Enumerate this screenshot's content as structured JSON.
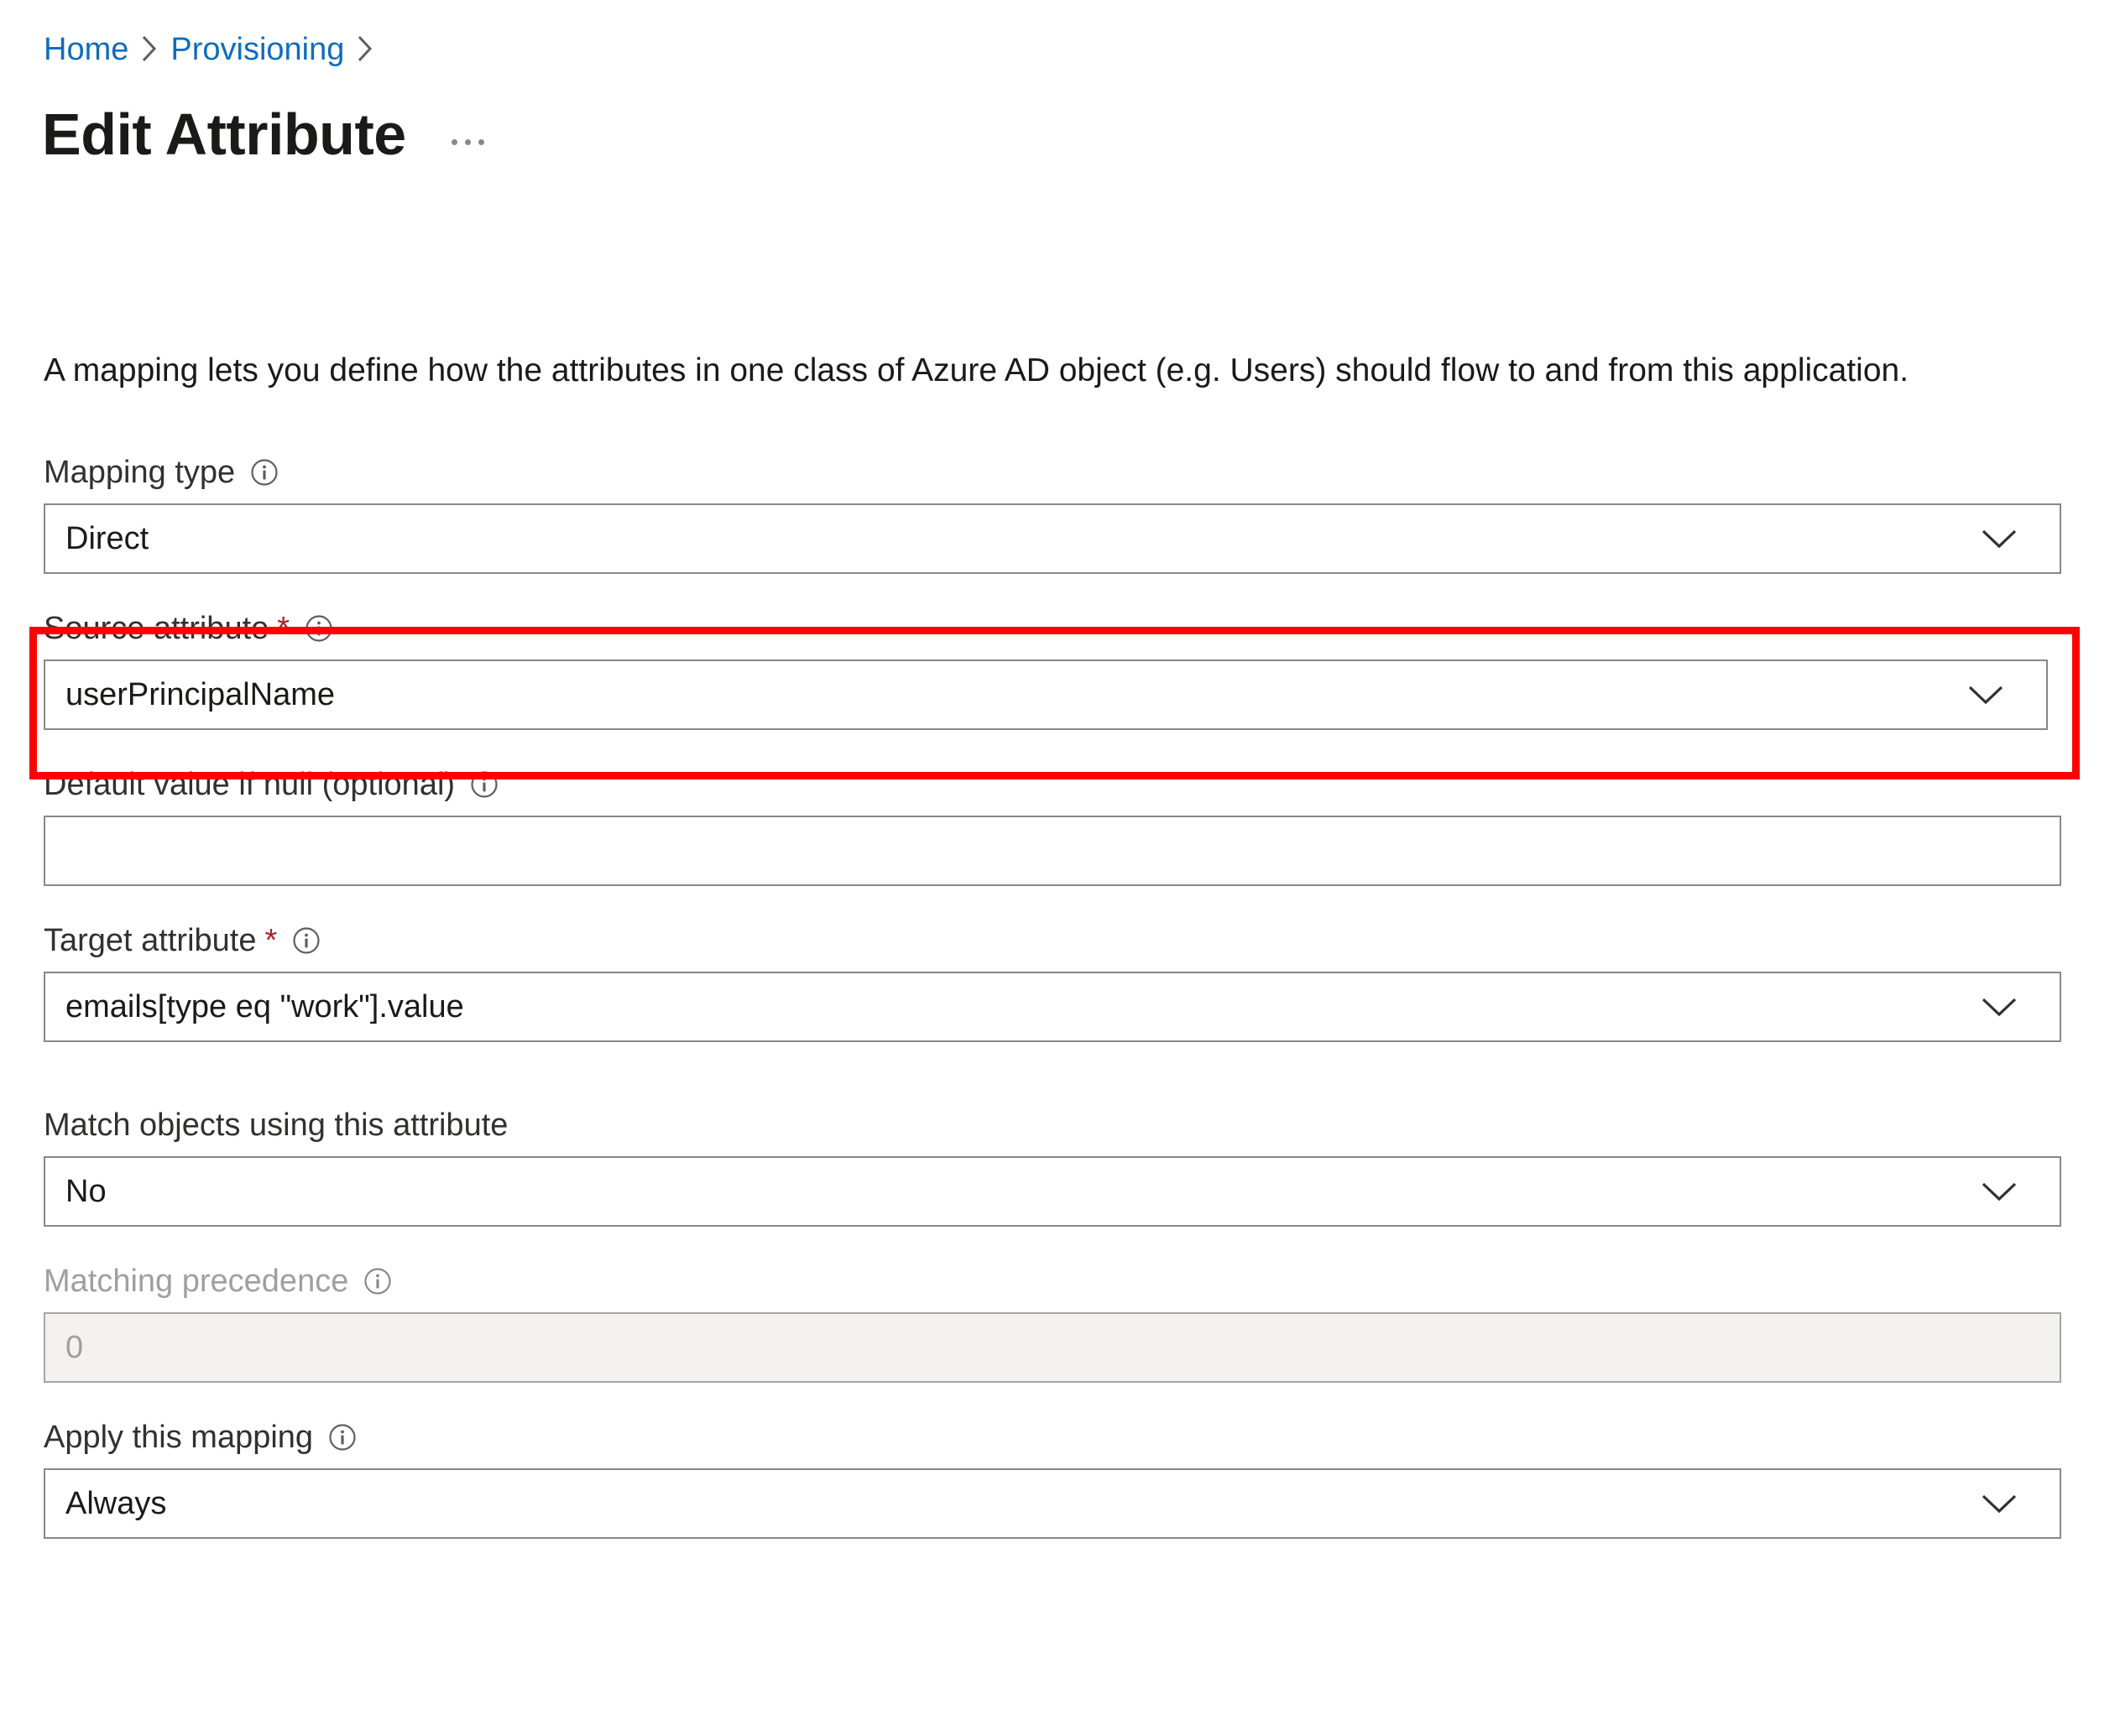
{
  "breadcrumb": {
    "items": [
      {
        "label": "Home"
      },
      {
        "label": "Provisioning"
      }
    ],
    "separator": "chevron-right-icon"
  },
  "header": {
    "title": "Edit Attribute",
    "more_menu": "..."
  },
  "description": "A mapping lets you define how the attributes in one class of Azure AD object (e.g. Users) should flow to and from this application.",
  "form": {
    "mapping_type": {
      "label": "Mapping type",
      "info": "info-icon",
      "value": "Direct",
      "control": "dropdown"
    },
    "source_attribute": {
      "label": "Source attribute",
      "required_marker": "*",
      "info": "info-icon",
      "value": "userPrincipalName",
      "control": "dropdown",
      "highlighted": true,
      "highlight_color": "#ff0000"
    },
    "default_value": {
      "label": "Default value if null (optional)",
      "info": "info-icon",
      "value": "",
      "placeholder": "",
      "control": "textbox"
    },
    "target_attribute": {
      "label": "Target attribute",
      "required_marker": "*",
      "info": "info-icon",
      "value": "emails[type eq \"work\"].value",
      "control": "dropdown"
    },
    "match_objects": {
      "label": "Match objects using this attribute",
      "value": "No",
      "control": "dropdown"
    },
    "matching_precedence": {
      "label": "Matching precedence",
      "info": "info-icon",
      "value": "0",
      "control": "textbox",
      "disabled": true
    },
    "apply_mapping": {
      "label": "Apply this mapping",
      "info": "info-icon",
      "value": "Always",
      "control": "dropdown"
    }
  },
  "colors": {
    "link": "#0f6cbd",
    "required": "#a4262c",
    "border": "#8a8886",
    "highlight": "#ff0000",
    "disabled_bg": "#f3f2f1",
    "text": "#1b1a19"
  }
}
